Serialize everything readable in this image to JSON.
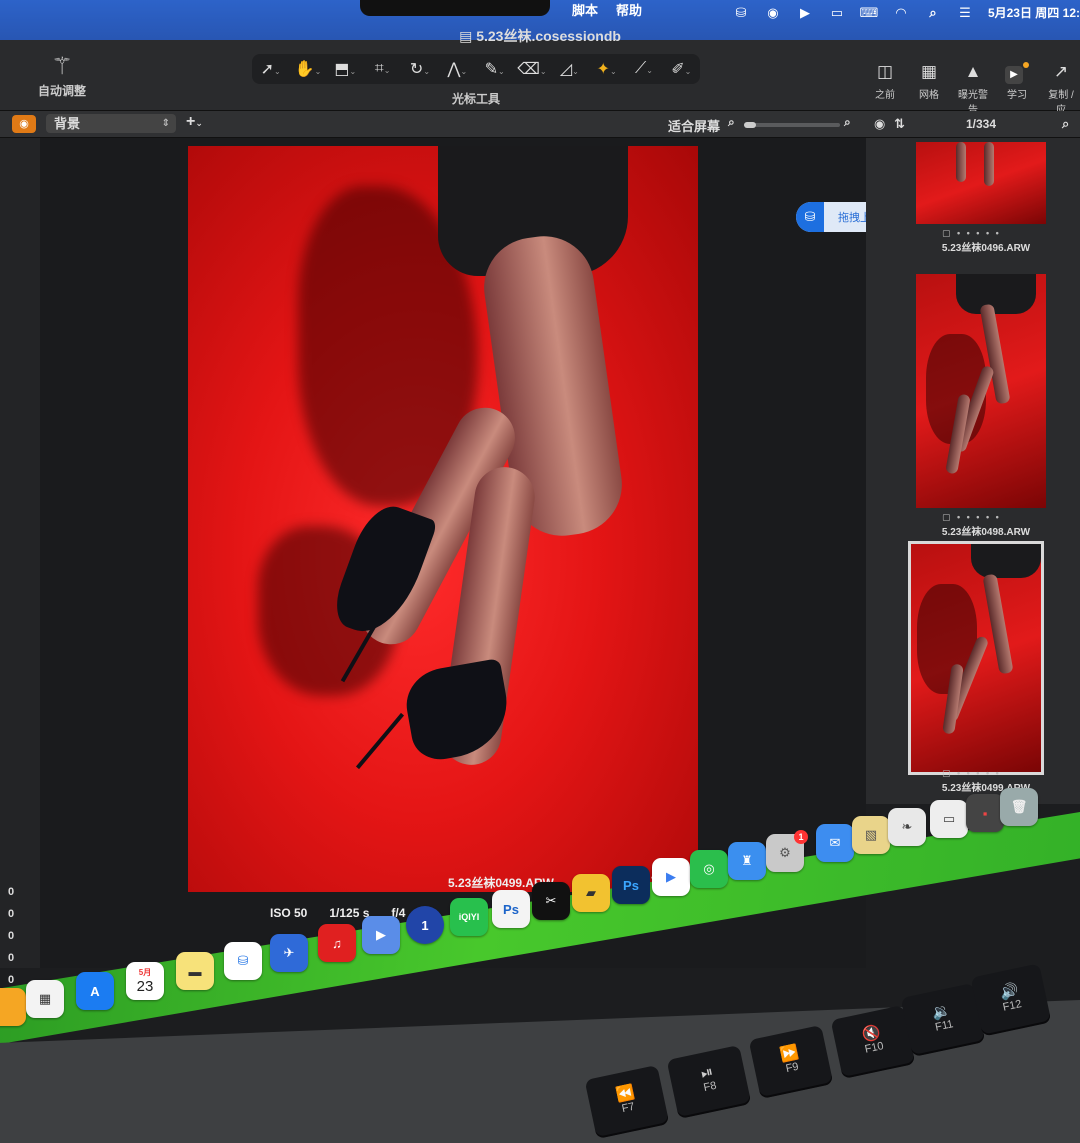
{
  "menubar": {
    "menu_items": [
      "脚本",
      "帮助"
    ],
    "date_time": "5月23日 周四 12:",
    "status_icons": [
      "baidu-netdisk-icon",
      "record-icon",
      "play-circle-icon",
      "battery-icon",
      "keyboard-input-icon",
      "wifi-icon",
      "search-icon",
      "control-center-icon"
    ]
  },
  "toolbar": {
    "document_title": "5.23丝袜.cosessiondb",
    "auto_adjust_label": "自动调整",
    "cursor_tools_label": "光标工具",
    "right_tools": [
      {
        "label": "之前",
        "icon": "before-after-icon"
      },
      {
        "label": "网格",
        "icon": "grid-icon"
      },
      {
        "label": "曝光警告",
        "icon": "exposure-warning-icon"
      },
      {
        "label": "学习",
        "icon": "learn-icon"
      },
      {
        "label": "复制 / 应",
        "icon": "copy-apply-icon"
      }
    ]
  },
  "subbar": {
    "layer_name": "背景",
    "fit_label": "适合屏幕",
    "zoom_fraction": 0.12
  },
  "browser": {
    "image_counter": "1/334",
    "thumbnails": [
      {
        "filename": "5.23丝袜0496.ARW",
        "selected": false
      },
      {
        "filename": "5.23丝袜0498.ARW",
        "selected": false
      },
      {
        "filename": "5.23丝袜0499.ARW",
        "selected": true
      }
    ]
  },
  "upload_popup": {
    "label": "拖拽上传"
  },
  "viewer": {
    "filename": "5.23丝袜0499.ARW",
    "exif": {
      "iso": "ISO 50",
      "shutter": "1/125 s",
      "aperture": "f/4"
    }
  },
  "left_panel": {
    "values": [
      "0",
      "0",
      "0",
      "0",
      "0"
    ]
  },
  "dock": {
    "calendar": {
      "month": "5月",
      "day": "23"
    },
    "apps_labels": {
      "iqiyi": "iQIYI",
      "ps": "Ps",
      "capcut": "✂",
      "ps2": "Ps"
    },
    "badge": "1"
  },
  "keyboard": {
    "keys": [
      {
        "label": "F7",
        "symbol": "⏪"
      },
      {
        "label": "F8",
        "symbol": "⏯"
      },
      {
        "label": "F9",
        "symbol": "⏩"
      },
      {
        "label": "F10",
        "symbol": "🔇"
      },
      {
        "label": "F11",
        "symbol": "🔉"
      },
      {
        "label": "F12",
        "symbol": "🔊"
      }
    ]
  },
  "colors": {
    "accent": "#f2b21d",
    "dock_green": "#48c82c",
    "menubar_blue": "#2d63c9"
  }
}
